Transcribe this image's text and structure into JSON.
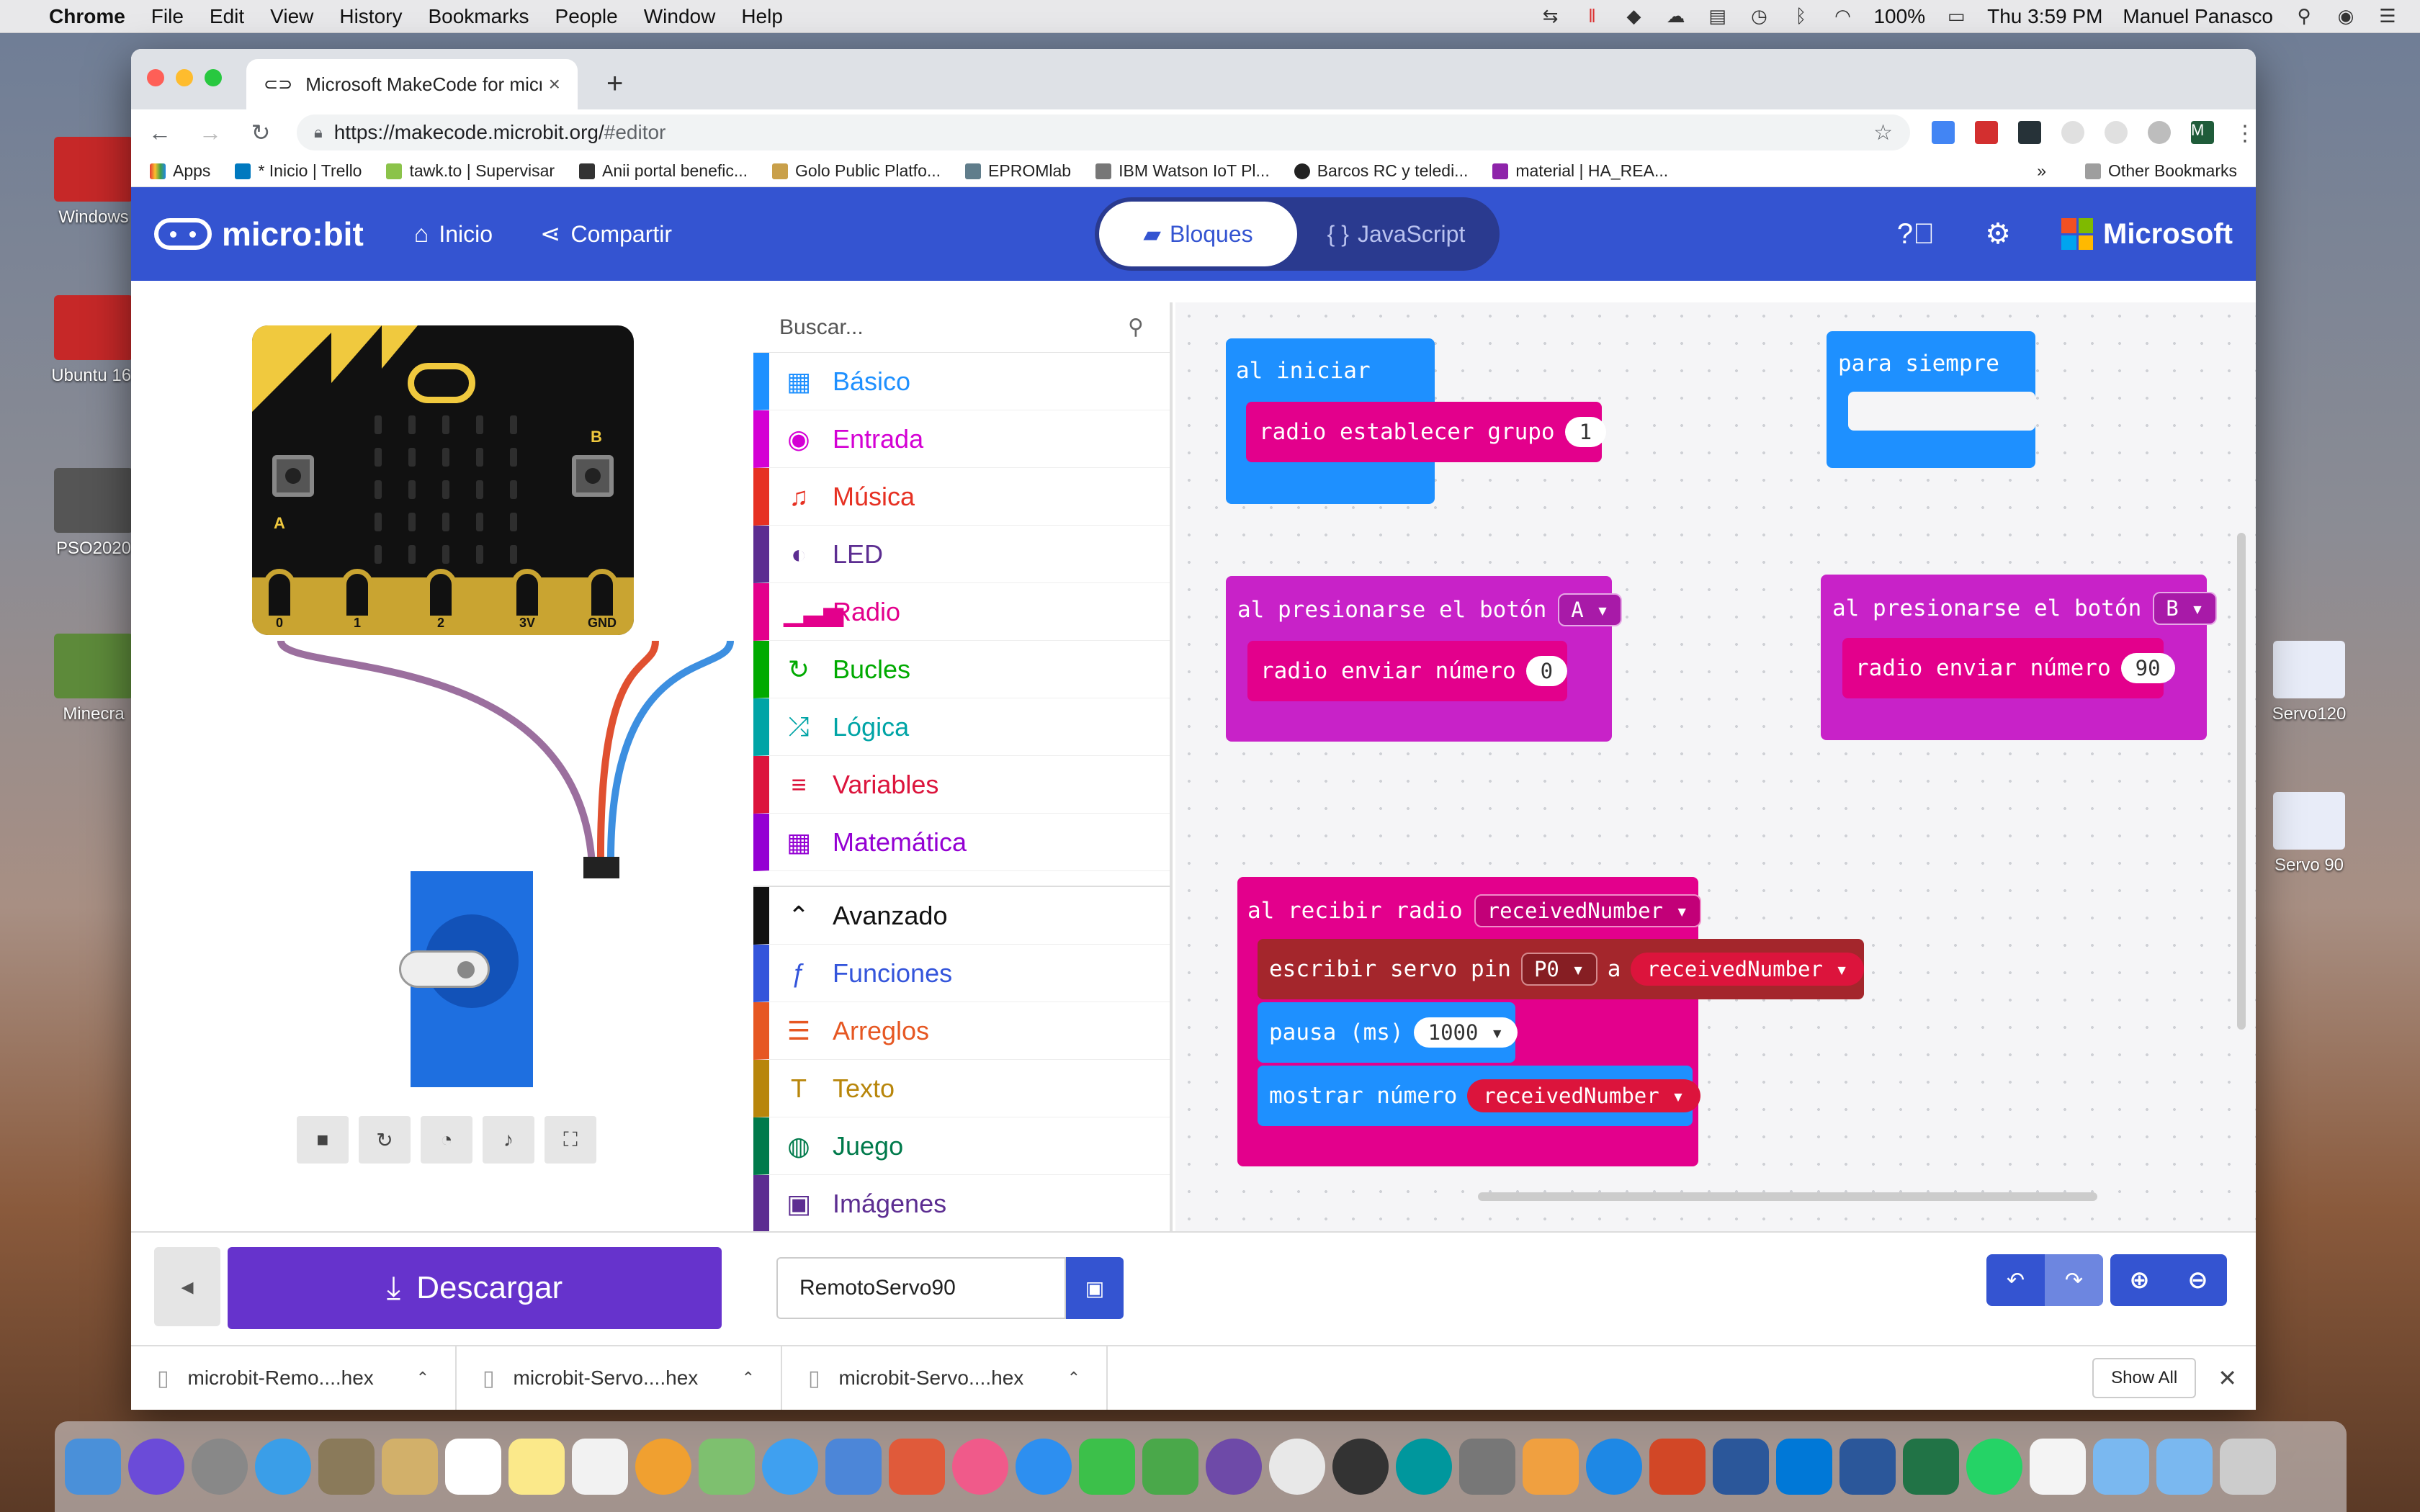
{
  "menubar": {
    "app": "Chrome",
    "items": [
      "File",
      "Edit",
      "View",
      "History",
      "Bookmarks",
      "People",
      "Window",
      "Help"
    ],
    "battery": "100%",
    "clock": "Thu 3:59 PM",
    "user": "Manuel Panasco"
  },
  "desktop": {
    "left_icons": [
      "Windows",
      "Ubuntu 16.",
      "PSO2020",
      "Minecra"
    ],
    "right_icons": [
      "Servo120",
      "Servo 90"
    ]
  },
  "browser": {
    "tab_title": "Microsoft MakeCode for micro:",
    "url_host": "https://makecode.microbit.org/",
    "url_path": "#editor",
    "profile_initial": "M",
    "bookmarks": [
      "Apps",
      "* Inicio | Trello",
      "tawk.to | Supervisar",
      "Anii portal benefic...",
      "Golo Public Platfo...",
      "EPROMlab",
      "IBM Watson IoT Pl...",
      "Barcos RC y teledi...",
      "material | HA_REA..."
    ],
    "more_bookmarks": "»",
    "other_bookmarks": "Other Bookmarks"
  },
  "makecode": {
    "logo": "micro:bit",
    "home": "Inicio",
    "share": "Compartir",
    "mode_blocks": "Bloques",
    "mode_js": "JavaScript",
    "brand": "Microsoft"
  },
  "simulator": {
    "pins": [
      "0",
      "1",
      "2",
      "3V",
      "GND"
    ],
    "button_a": "A",
    "button_b": "B"
  },
  "toolbox": {
    "search_placeholder": "Buscar...",
    "categories": [
      {
        "label": "Básico",
        "color": "#1e90ff",
        "icon": "grid-icon",
        "glyph": "▦"
      },
      {
        "label": "Entrada",
        "color": "#d400d4",
        "icon": "target-icon",
        "glyph": "◉"
      },
      {
        "label": "Música",
        "color": "#e63022",
        "icon": "headphones-icon",
        "glyph": "♫"
      },
      {
        "label": "LED",
        "color": "#5c2d91",
        "icon": "toggle-icon",
        "glyph": "◐"
      },
      {
        "label": "Radio",
        "color": "#e3008c",
        "icon": "signal-icon",
        "glyph": "▁▃▅"
      },
      {
        "label": "Bucles",
        "color": "#00aa00",
        "icon": "refresh-icon",
        "glyph": "↻"
      },
      {
        "label": "Lógica",
        "color": "#00a4a6",
        "icon": "shuffle-icon",
        "glyph": "⤮"
      },
      {
        "label": "Variables",
        "color": "#dc143c",
        "icon": "list-icon",
        "glyph": "≡"
      },
      {
        "label": "Matemática",
        "color": "#9400d3",
        "icon": "calculator-icon",
        "glyph": "▦"
      }
    ],
    "advanced": {
      "label": "Avanzado",
      "color": "#111111",
      "icon": "chevron-up-icon",
      "glyph": "⌃"
    },
    "advanced_categories": [
      {
        "label": "Funciones",
        "color": "#3455db",
        "icon": "function-icon",
        "glyph": "ƒ"
      },
      {
        "label": "Arreglos",
        "color": "#e65722",
        "icon": "list-ordered-icon",
        "glyph": "☰"
      },
      {
        "label": "Texto",
        "color": "#b8860b",
        "icon": "text-icon",
        "glyph": "T"
      },
      {
        "label": "Juego",
        "color": "#007a4b",
        "icon": "gamepad-icon",
        "glyph": "◍"
      },
      {
        "label": "Imágenes",
        "color": "#5c2d91",
        "icon": "image-icon",
        "glyph": "▣"
      }
    ]
  },
  "workspace": {
    "on_start": {
      "label": "al iniciar",
      "inner": "radio establecer grupo",
      "value": "1"
    },
    "forever": {
      "label": "para siempre"
    },
    "button_a": {
      "label": "al presionarse el botón",
      "button": "A",
      "inner": "radio enviar número",
      "value": "0"
    },
    "button_b": {
      "label": "al presionarse el botón",
      "button": "B",
      "inner": "radio enviar número",
      "value": "90"
    },
    "on_receive": {
      "label": "al recibir radio",
      "var": "receivedNumber",
      "servo": "escribir servo pin",
      "pin": "P0",
      "to": "a",
      "servo_var": "receivedNumber",
      "pause": "pausa (ms)",
      "pause_value": "1000",
      "show": "mostrar número",
      "show_var": "receivedNumber"
    }
  },
  "bottombar": {
    "download": "Descargar",
    "project_name": "RemotoServo90"
  },
  "downloads": {
    "items": [
      "microbit-Remo....hex",
      "microbit-Servo....hex",
      "microbit-Servo....hex"
    ],
    "show_all": "Show All"
  },
  "colors": {
    "header": "#3454d1",
    "download": "#6633cc",
    "basic": "#1e90ff",
    "input": "#d400d4",
    "radio": "#e3008c",
    "servo_block": "#a4262c"
  }
}
